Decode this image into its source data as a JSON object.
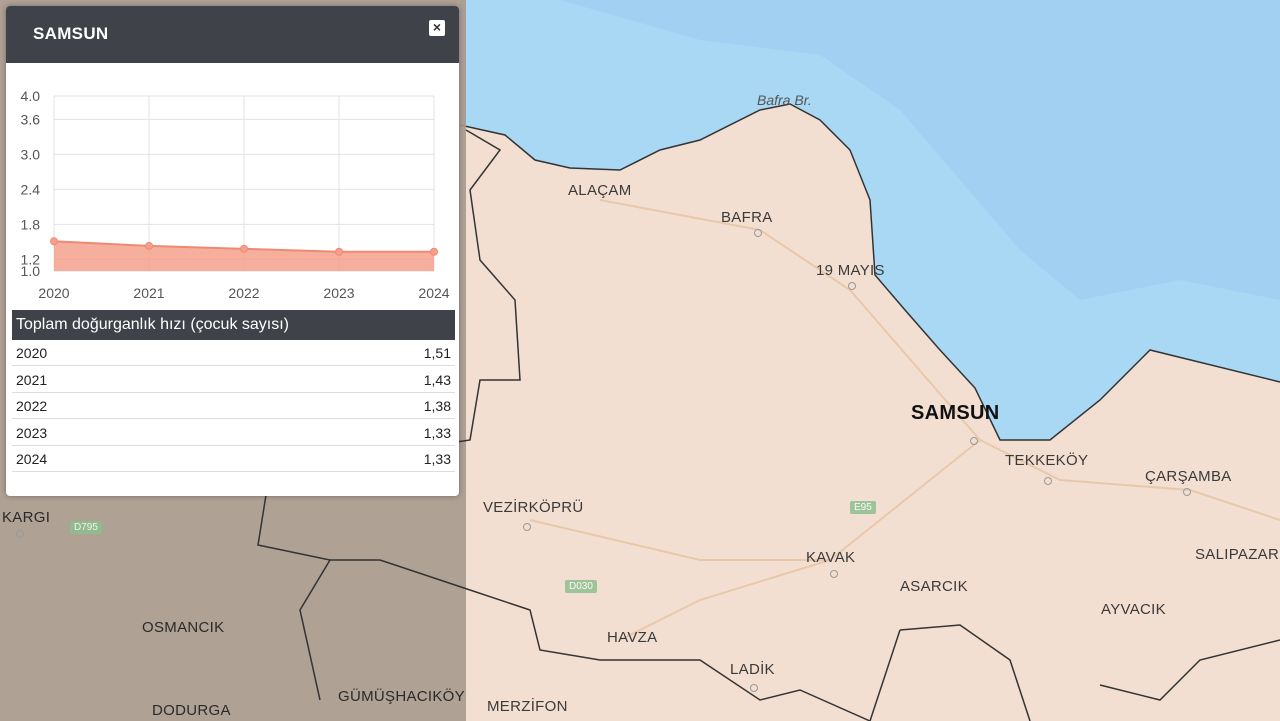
{
  "popup": {
    "title": "SAMSUN",
    "close_symbol": "×",
    "table_header": "Toplam doğurganlık hızı (çocuk sayısı)",
    "rows": [
      {
        "year": "2020",
        "value": "1,51"
      },
      {
        "year": "2021",
        "value": "1,43"
      },
      {
        "year": "2022",
        "value": "1,38"
      },
      {
        "year": "2023",
        "value": "1,33"
      },
      {
        "year": "2024",
        "value": "1,33"
      }
    ]
  },
  "chart_data": {
    "type": "area",
    "x": [
      "2020",
      "2021",
      "2022",
      "2023",
      "2024"
    ],
    "values": [
      1.51,
      1.43,
      1.38,
      1.33,
      1.33
    ],
    "y_ticks": [
      "4.0",
      "3.6",
      "3.0",
      "2.4",
      "1.8",
      "1.2",
      "1.0"
    ],
    "y_tick_values": [
      4.0,
      3.6,
      3.0,
      2.4,
      1.8,
      1.2,
      1.0
    ],
    "ylim": [
      1.0,
      4.0
    ],
    "grid": true,
    "color": "#f4a08c"
  },
  "map": {
    "sea_label": "Bafra Br.",
    "samsun_label": "SAMSUN",
    "places": {
      "alacam": "ALAÇAM",
      "bafra": "BAFRA",
      "ondokuzmayis": "19 MAYIS",
      "tekkekoy": "TEKKEKÖY",
      "carsamba": "ÇARŞAMBA",
      "vezirkopru": "VEZİRKÖPRÜ",
      "kavak": "KAVAK",
      "asarcik": "ASARCIK",
      "salipazari": "SALIPAZARI",
      "ayvacik": "AYVACIK",
      "havza": "HAVZA",
      "ladik": "LADİK",
      "merzifon": "MERZİFON",
      "gumushacikoy": "GÜMÜŞHACIKÖY",
      "osmancik": "OSMANCIK",
      "dodurga": "DODURGA",
      "kargi": "KARGI"
    },
    "roads": {
      "e95": "E95",
      "d030": "D030",
      "d795": "D795"
    },
    "colors": {
      "sea": "#a9d8f5",
      "land": "#f3dfd2",
      "shaded": "#a89a8e"
    }
  }
}
